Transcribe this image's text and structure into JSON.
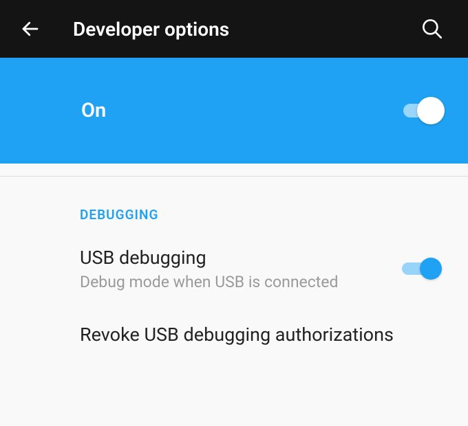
{
  "header": {
    "title": "Developer options"
  },
  "status": {
    "label": "On",
    "enabled": true
  },
  "section": {
    "header": "DEBUGGING"
  },
  "settings": [
    {
      "title": "USB debugging",
      "subtitle": "Debug mode when USB is connected",
      "enabled": true
    },
    {
      "title": "Revoke USB debugging authorizations"
    }
  ],
  "colors": {
    "accent": "#1fa2f3",
    "header_bg": "#141414"
  }
}
